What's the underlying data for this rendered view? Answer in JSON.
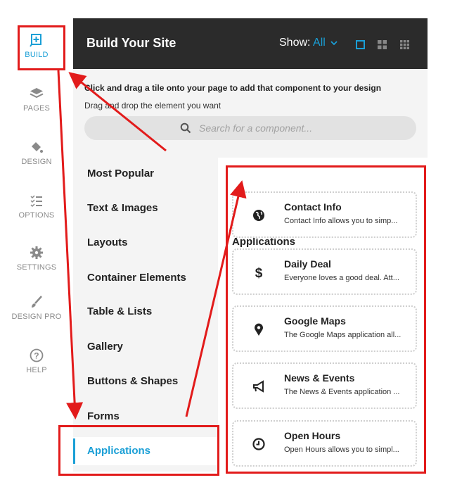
{
  "rail": {
    "items": [
      {
        "label": "BUILD",
        "icon": "build-plus-icon",
        "active": true
      },
      {
        "label": "PAGES",
        "icon": "layers-icon"
      },
      {
        "label": "DESIGN",
        "icon": "paint-bucket-icon"
      },
      {
        "label": "OPTIONS",
        "icon": "checklist-icon"
      },
      {
        "label": "SETTINGS",
        "icon": "gear-icon"
      },
      {
        "label": "DESIGN PRO",
        "icon": "brush-icon"
      },
      {
        "label": "HELP",
        "icon": "question-icon"
      }
    ]
  },
  "header": {
    "title": "Build Your Site",
    "show_label": "Show:",
    "show_value": "All"
  },
  "instructions": {
    "line1": "Click and drag a tile onto your page to add that component to your design",
    "line2": "Drag and drop the element you want"
  },
  "search": {
    "placeholder": "Search for a component..."
  },
  "categories": [
    {
      "label": "Most Popular"
    },
    {
      "label": "Text & Images"
    },
    {
      "label": "Layouts"
    },
    {
      "label": "Container Elements"
    },
    {
      "label": "Table & Lists"
    },
    {
      "label": "Gallery"
    },
    {
      "label": "Buttons & Shapes"
    },
    {
      "label": "Forms"
    },
    {
      "label": "Applications",
      "active": true
    }
  ],
  "applications": {
    "title": "Applications",
    "tiles": [
      {
        "name": "Contact Info",
        "desc": "Contact Info allows you to simp...",
        "icon": "globe-icon"
      },
      {
        "name": "Daily Deal",
        "desc": "Everyone loves a good deal. Att...",
        "icon": "dollar-icon"
      },
      {
        "name": "Google Maps",
        "desc": "The Google Maps application all...",
        "icon": "map-pin-icon"
      },
      {
        "name": "News & Events",
        "desc": "The News & Events application ...",
        "icon": "megaphone-icon"
      },
      {
        "name": "Open Hours",
        "desc": "Open Hours allows you to simpl...",
        "icon": "clock-icon"
      }
    ]
  },
  "colors": {
    "accent": "#1a9fd6",
    "annotation": "#e21b1b",
    "header_bg": "#2b2b2b"
  }
}
